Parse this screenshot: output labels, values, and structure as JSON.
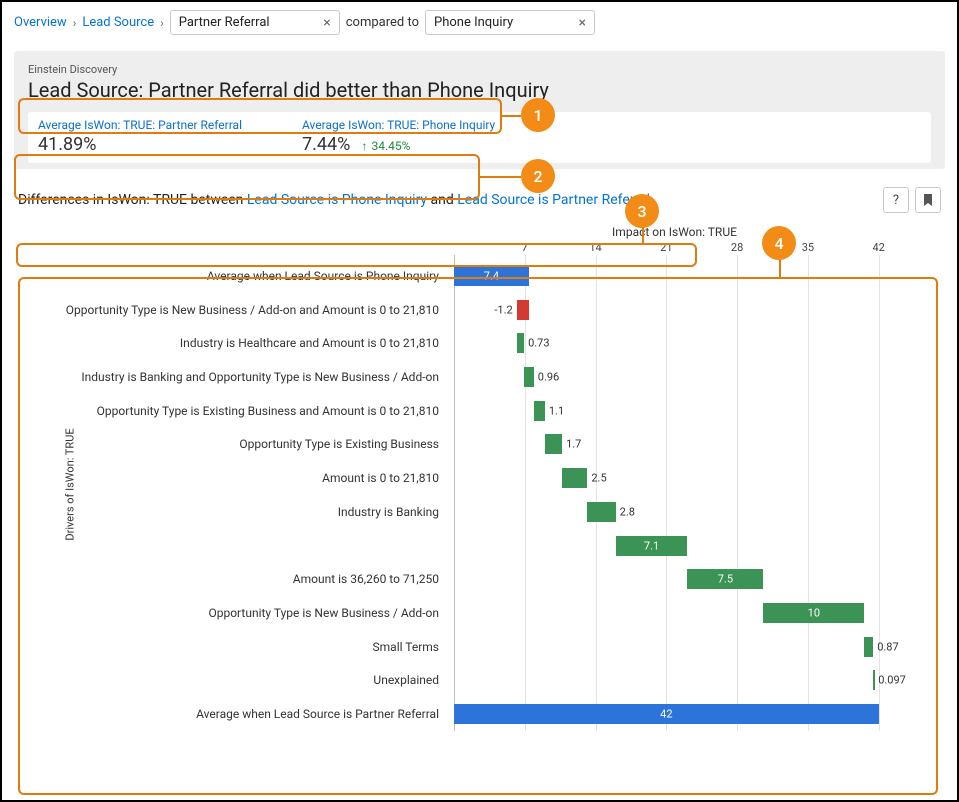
{
  "breadcrumb": {
    "overview": "Overview",
    "lead_source": "Lead Source",
    "pill1": "Partner Referral",
    "compared_to": "compared to",
    "pill2": "Phone Inquiry"
  },
  "header": {
    "ed_label": "Einstein Discovery",
    "title": "Lead Source: Partner Referral did better than Phone Inquiry"
  },
  "stats": {
    "left_label": "Average IsWon: TRUE: Partner Referral",
    "left_value": "41.89%",
    "right_label": "Average IsWon: TRUE: Phone Inquiry",
    "right_value": "7.44%",
    "delta": "34.45%"
  },
  "diff": {
    "prefix": "Differences in IsWon: TRUE between ",
    "link1": "Lead Source is Phone Inquiry",
    "and": " and ",
    "link2": "Lead Source is Partner Referral"
  },
  "badges": {
    "b1": "1",
    "b2": "2",
    "b3": "3",
    "b4": "4"
  },
  "chart_meta": {
    "title": "Impact on IsWon: TRUE",
    "ylabel": "Drivers of IsWon: TRUE"
  },
  "chart_data": {
    "type": "waterfall",
    "title": "Impact on IsWon: TRUE",
    "ylabel": "Drivers of IsWon: TRUE",
    "xlabel": "",
    "x_ticks": [
      7,
      14,
      21,
      28,
      35,
      42
    ],
    "xlim": [
      0,
      45
    ],
    "categories": [
      "Average when Lead Source is Phone Inquiry",
      "Opportunity Type is New Business / Add-on and Amount is 0 to 21,810",
      "Industry is Healthcare and Amount is 0 to 21,810",
      "Industry is Banking and Opportunity Type is New Business / Add-on",
      "Opportunity Type is Existing Business and Amount is 0 to 21,810",
      "Opportunity Type is Existing Business",
      "Amount is 0 to 21,810",
      "Industry is Banking",
      "",
      "Amount is 36,260 to 71,250",
      "Opportunity Type is New Business / Add-on",
      "Small Terms",
      "Unexplained",
      "Average when Lead Source is Partner Referral"
    ],
    "bars": [
      {
        "start": 0,
        "end": 7.4,
        "color": "blue",
        "label": "7.4"
      },
      {
        "start": 7.4,
        "end": 6.2,
        "color": "red",
        "label": "-1.2"
      },
      {
        "start": 6.2,
        "end": 6.93,
        "color": "green",
        "label": "0.73"
      },
      {
        "start": 6.93,
        "end": 7.89,
        "color": "green",
        "label": "0.96"
      },
      {
        "start": 7.89,
        "end": 8.99,
        "color": "green",
        "label": "1.1"
      },
      {
        "start": 8.99,
        "end": 10.69,
        "color": "green",
        "label": "1.7"
      },
      {
        "start": 10.69,
        "end": 13.19,
        "color": "green",
        "label": "2.5"
      },
      {
        "start": 13.19,
        "end": 15.99,
        "color": "green",
        "label": "2.8"
      },
      {
        "start": 15.99,
        "end": 23.09,
        "color": "green",
        "label": "7.1"
      },
      {
        "start": 23.09,
        "end": 30.59,
        "color": "green",
        "label": "7.5"
      },
      {
        "start": 30.59,
        "end": 40.59,
        "color": "green",
        "label": "10"
      },
      {
        "start": 40.59,
        "end": 41.46,
        "color": "green",
        "label": "0.87"
      },
      {
        "start": 41.46,
        "end": 41.56,
        "color": "green",
        "label": "0.097"
      },
      {
        "start": 0,
        "end": 42,
        "color": "blue",
        "label": "42"
      }
    ],
    "colors": {
      "blue": "#2d74da",
      "green": "#3b9455",
      "red": "#d43a2f"
    }
  }
}
